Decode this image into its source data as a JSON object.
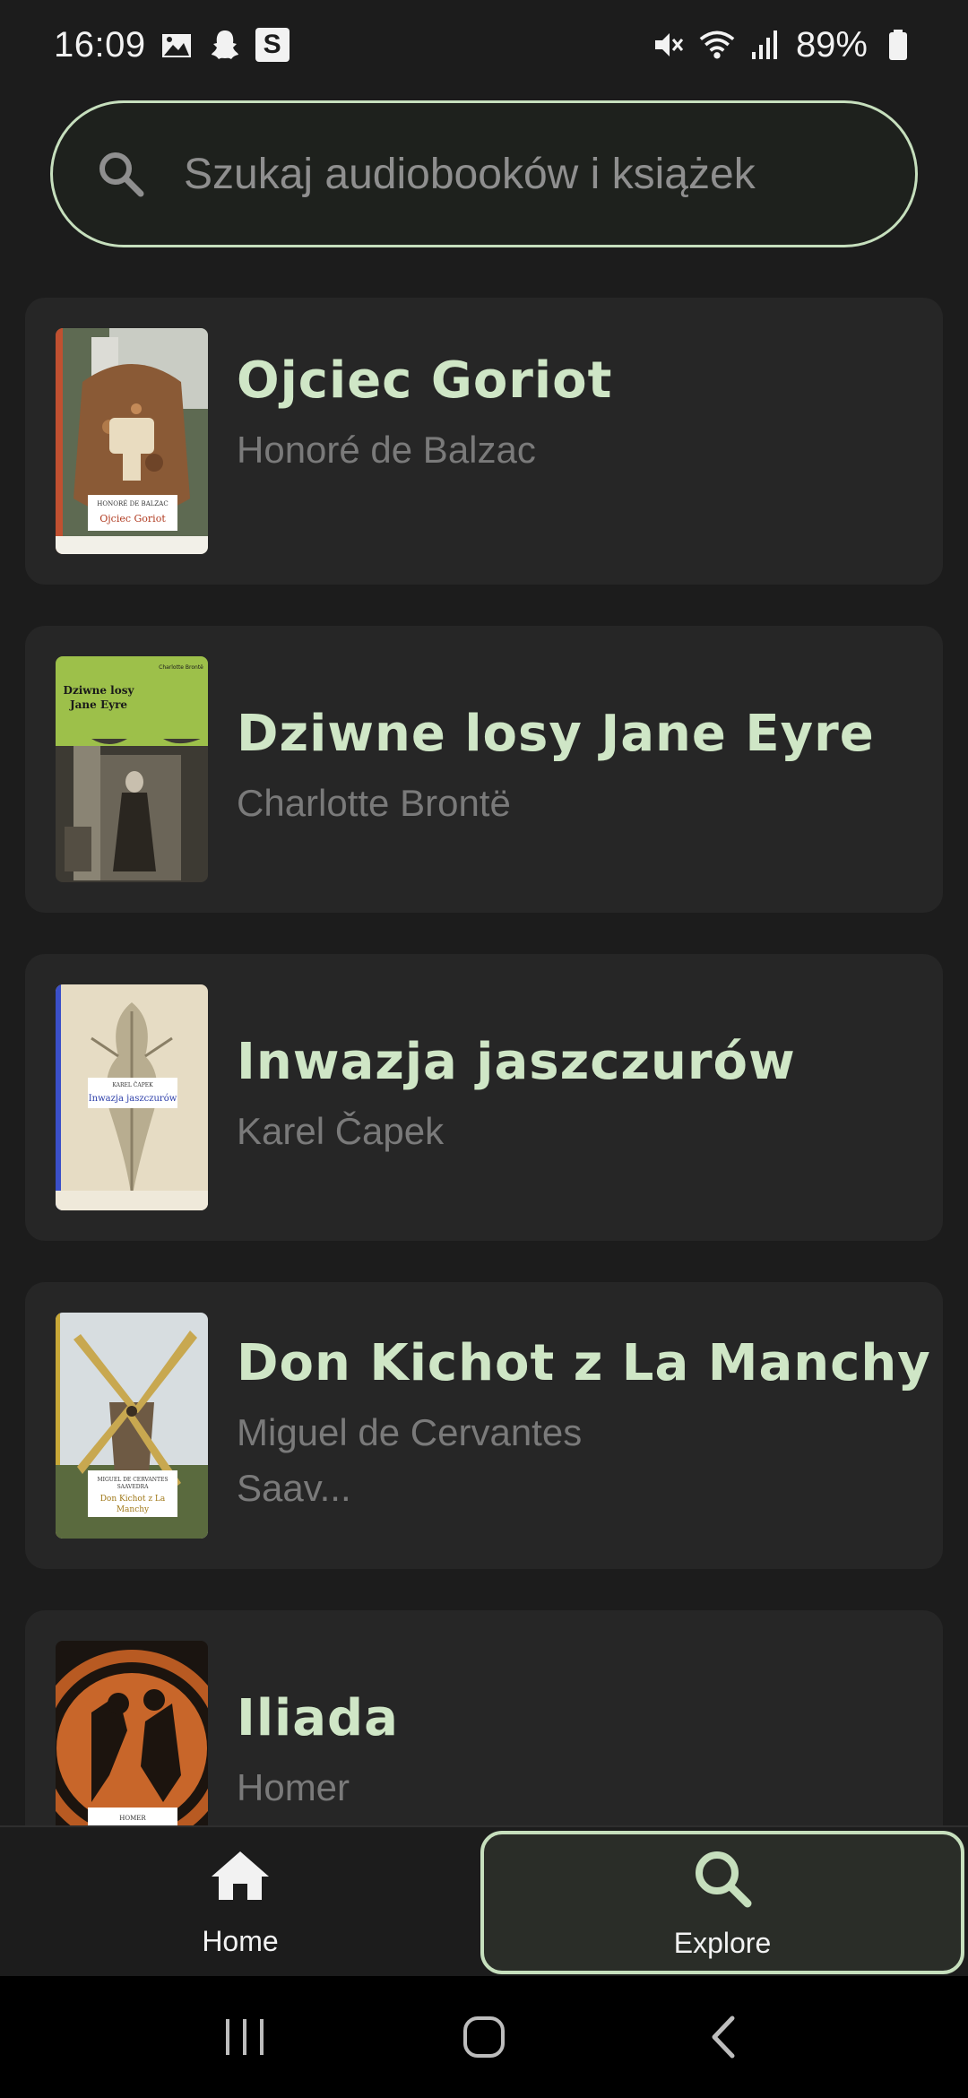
{
  "status_bar": {
    "time": "16:09",
    "battery_percent": "89%",
    "left_icons": [
      "gallery-icon",
      "snapchat-icon",
      "s-app-icon"
    ],
    "right_icons": [
      "mute-icon",
      "wifi-icon",
      "signal-icon",
      "battery-icon"
    ],
    "s_app_label": "S"
  },
  "search": {
    "placeholder": "Szukaj audiobooków i książek"
  },
  "books": [
    {
      "title": "Ojciec Goriot",
      "author": "Honoré de Balzac",
      "cover_text": "Ojciec Goriot",
      "cover_author": "HONORÉ DE BALZAC"
    },
    {
      "title": "Dziwne losy Jane Eyre",
      "author": "Charlotte Brontë",
      "cover_text": "Dziwne losy Jane Eyre",
      "cover_author": "Charlotte Brontë"
    },
    {
      "title": "Inwazja jaszczurów",
      "author": "Karel Čapek",
      "cover_text": "Inwazja jaszczurów",
      "cover_author": "KAREL ČAPEK"
    },
    {
      "title": "Don Kichot z La Manchy",
      "author": "Miguel de Cervantes Saav...",
      "cover_text": "Don Kichot z La Manchy",
      "cover_author": "MIGUEL DE CERVANTES SAAVEDRA"
    },
    {
      "title": "Iliada",
      "author": "Homer",
      "cover_text": "",
      "cover_author": "HOMER"
    }
  ],
  "bottom_nav": {
    "home_label": "Home",
    "explore_label": "Explore",
    "selected": "Explore"
  },
  "colors": {
    "accent": "#c6dfbd",
    "title": "#cfe6c6",
    "card": "#262626",
    "background": "#1c1c1c"
  }
}
